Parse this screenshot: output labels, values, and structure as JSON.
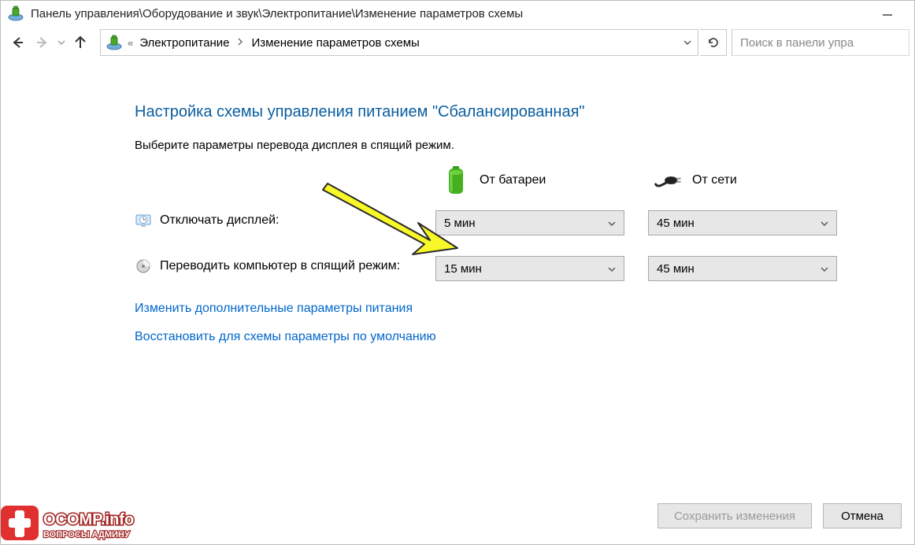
{
  "titlebar": {
    "path": "Панель управления\\Оборудование и звук\\Электропитание\\Изменение параметров схемы"
  },
  "breadcrumb": {
    "crumb1": "Электропитание",
    "crumb2": "Изменение параметров схемы"
  },
  "search": {
    "placeholder": "Поиск в панели упра"
  },
  "page": {
    "title": "Настройка схемы управления питанием \"Сбалансированная\"",
    "subtitle": "Выберите параметры перевода дисплея в спящий режим."
  },
  "columns": {
    "battery": "От батареи",
    "plugged": "От сети"
  },
  "rows": {
    "display_off": {
      "label": "Отключать дисплей:",
      "battery": "5 мин",
      "plugged": "45 мин"
    },
    "sleep": {
      "label": "Переводить компьютер в спящий режим:",
      "battery": "15 мин",
      "plugged": "45 мин"
    }
  },
  "links": {
    "advanced": "Изменить дополнительные параметры питания",
    "restore": "Восстановить для схемы параметры по умолчанию"
  },
  "footer": {
    "save": "Сохранить изменения",
    "cancel": "Отмена"
  },
  "watermark": {
    "line1": "OCOMP.info",
    "line2": "ВОПРОСЫ АДМИНУ"
  }
}
